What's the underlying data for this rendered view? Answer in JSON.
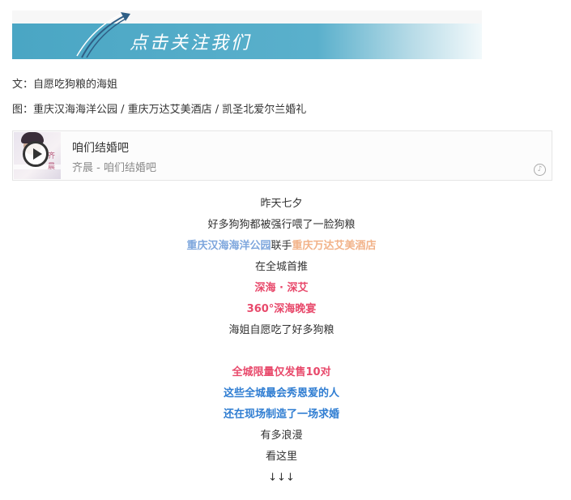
{
  "banner": {
    "text": "点击关注我们"
  },
  "credits": {
    "text_line": "文：自愿吃狗粮的海姐",
    "photo_line": "图：重庆汉海海洋公园 / 重庆万达艾美酒店 / 凯圣北爱尔兰婚礼"
  },
  "player": {
    "title": "咱们结婚吧",
    "subtitle": "齐晨 - 咱们结婚吧",
    "cover_text": "齐晨",
    "play_icon": "play-icon",
    "music_icon": "music-logo-icon"
  },
  "article": {
    "l1": "昨天七夕",
    "l2": "好多狗狗都被强行喂了一脸狗粮",
    "l3a": "重庆汉海海洋公园",
    "l3b": "联手",
    "l3c": "重庆万达艾美酒店",
    "l4": "在全城首推",
    "l5": "深海 · 深艾",
    "l6": "360°深海晚宴",
    "l7": "海姐自愿吃了好多狗粮",
    "l8": "全城限量仅发售10对",
    "l9": "这些全城最会秀恩爱的人",
    "l10": "还在现场制造了一场求婚",
    "l11": "有多浪漫",
    "l12": "看这里",
    "l13": "↓↓↓"
  },
  "colors": {
    "banner_blue": "#4aa6c4",
    "highlight_blue": "#7fa7dd",
    "highlight_orange": "#f2b38a",
    "highlight_pink": "#e8496b",
    "highlight_deep_blue": "#2f7dd2"
  }
}
